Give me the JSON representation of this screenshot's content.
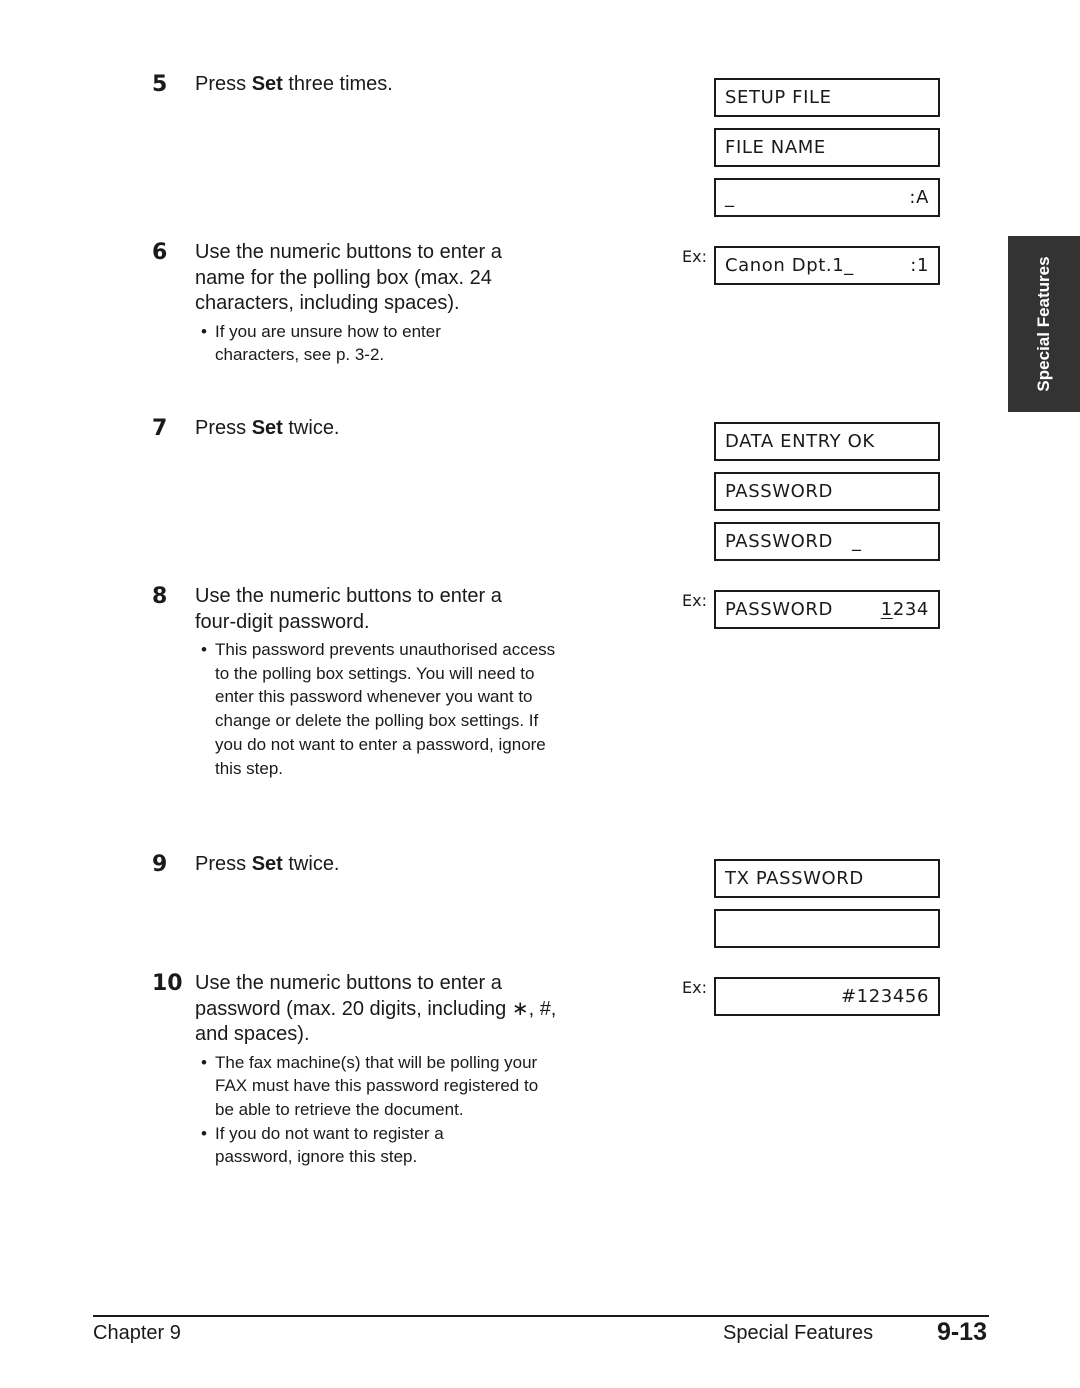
{
  "steps": [
    {
      "num": "5",
      "pre": "Press ",
      "bold": "Set",
      "post": " three times.",
      "bullets": []
    },
    {
      "num": "6",
      "pre": "Use the numeric buttons to enter a name for the polling box (max. 24 characters, including spaces).",
      "bold": "",
      "post": "",
      "bullets": [
        "If you are unsure how to enter characters, see p. 3-2."
      ]
    },
    {
      "num": "7",
      "pre": "Press ",
      "bold": "Set",
      "post": " twice.",
      "bullets": []
    },
    {
      "num": "8",
      "pre": "Use the numeric buttons to enter a four-digit password.",
      "bold": "",
      "post": "",
      "bullets": [
        "This password prevents unauthorised access to the polling box settings. You will need to enter this password whenever you want to change or delete the polling box settings. If you do not want to enter a password, ignore this step."
      ]
    },
    {
      "num": "9",
      "pre": "Press ",
      "bold": "Set",
      "post": " twice.",
      "bullets": []
    },
    {
      "num": "10",
      "pre": "Use the numeric buttons to enter a password (max. 20 digits, including ∗, #, and spaces).",
      "bold": "",
      "post": "",
      "bullets": [
        "The fax machine(s) that will be polling your FAX must have this password registered to be able to retrieve the document.",
        "If you do not want to register a password, ignore this step."
      ]
    }
  ],
  "example_label": "Ex:",
  "displays": [
    {
      "left": "SETUP FILE",
      "right": ""
    },
    {
      "left": "FILE NAME",
      "right": ""
    },
    {
      "left": "_",
      "right": ":A"
    },
    {
      "left": "Canon Dpt.1_",
      "right": ":1"
    },
    {
      "left": "DATA ENTRY OK",
      "right": ""
    },
    {
      "left": "PASSWORD",
      "right": ""
    },
    {
      "left": "PASSWORD   _",
      "right": ""
    },
    {
      "left": "PASSWORD",
      "right_underlined": "1",
      "right": "234"
    },
    {
      "left": "TX PASSWORD",
      "right": ""
    },
    {
      "left": "",
      "right": ""
    },
    {
      "left": "",
      "right": "#123456"
    }
  ],
  "side_tab": "Special Features",
  "footer": {
    "chapter": "Chapter 9",
    "section": "Special Features",
    "page": "9-13"
  }
}
